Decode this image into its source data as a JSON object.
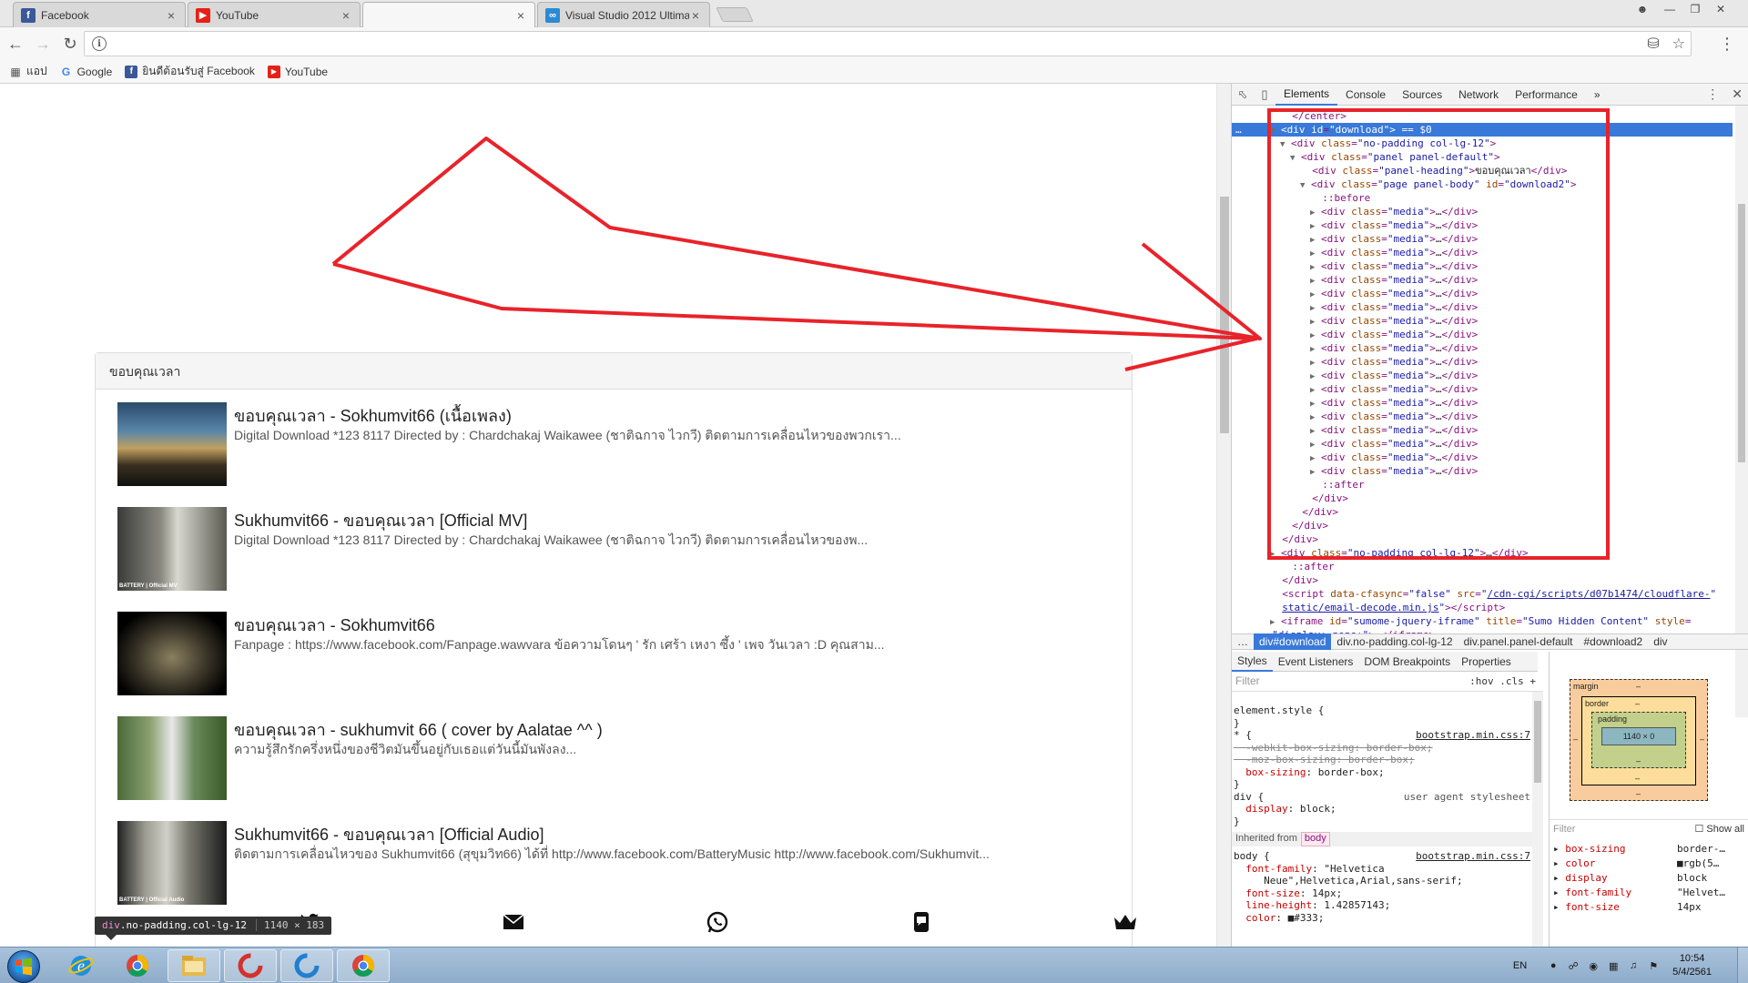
{
  "browser": {
    "tabs": [
      {
        "title": "Facebook",
        "icon": "facebook-icon",
        "color": "#3b5998",
        "active": false
      },
      {
        "title": "YouTube",
        "icon": "youtube-icon",
        "color": "#e62117",
        "active": false
      },
      {
        "title": "",
        "icon": "",
        "color": "",
        "active": true
      },
      {
        "title": "Visual Studio 2012 Ultima",
        "icon": "visual-studio-icon",
        "color": "#2a8ad4",
        "active": false
      }
    ],
    "address": "",
    "bookmarks": [
      {
        "label": "แอป",
        "icon": "apps-grid-icon"
      },
      {
        "label": "Google",
        "icon": "google-icon"
      },
      {
        "label": "ยินดีต้อนรับสู่ Facebook",
        "icon": "facebook-icon"
      },
      {
        "label": "YouTube",
        "icon": "youtube-icon"
      }
    ]
  },
  "page": {
    "panel_heading": "ขอบคุณเวลา",
    "videos": [
      {
        "title": "ขอบคุณเวลา - Sokhumvit66 (เนื้อเพลง)",
        "description": "Digital Download *123 8117 Directed by : Chardchakaj Waikawee (ชาติฉกาจ ไวกวี) ติดตามการเคลื่อนไหวของพวกเรา..."
      },
      {
        "title": "Sukhumvit66 - ขอบคุณเวลา [Official MV]",
        "description": "Digital Download *123 8117 Directed by : Chardchakaj Waikawee (ชาติฉกาจ ไวกวี) ติดตามการเคลื่อนไหวของพ..."
      },
      {
        "title": "ขอบคุณเวลา - Sokhumvit66",
        "description": "Fanpage : https://www.facebook.com/Fanpage.wawvara ข้อความโดนๆ ' รัก เศร้า เหงา ซึ้ง ' เพจ วันเวลา :D คุณสาม..."
      },
      {
        "title": "ขอบคุณเวลา - sukhumvit 66 ( cover by Aalatae ^^ )",
        "description": "ความรู้สึกรักครึ่งหนึ่งของชีวิตมันขึ้นอยู่กับเธอแต่วันนี้มันพังลง..."
      },
      {
        "title": "Sukhumvit66 - ขอบคุณเวลา [Official Audio]",
        "description": "ติดตามการเคลื่อนไหวของ Sukhumvit66 (สุขุมวิท66) ได้ที่ http://www.facebook.com/BatteryMusic http://www.facebook.com/Sukhumvit..."
      }
    ],
    "thumb_badges": [
      "",
      "BATTERY | Official MV",
      "",
      "",
      "BATTERY | Official Audio"
    ],
    "hover_tip": {
      "tag": "div",
      "classes": ".no-padding.col-lg-12",
      "dims": "1140 × 183"
    }
  },
  "devtools": {
    "tabs": [
      "Elements",
      "Console",
      "Sources",
      "Network",
      "Performance"
    ],
    "more": "»",
    "elements_lines": [
      {
        "indent": 3,
        "arrow": "",
        "html": "<span class='tag'>&lt;/center&gt;</span>"
      },
      {
        "indent": 2,
        "arrow": "▼",
        "sel": true,
        "html": "<span class='tag'>&lt;div</span> <span class='an'>id</span>=<span class='av'>\"download\"</span><span class='tag'>&gt;</span> <span class='tx'>== $0</span>"
      },
      {
        "indent": 3,
        "arrow": "▼",
        "html": "<span class='tag'>&lt;div</span> <span class='an'>class</span>=<span class='av'>\"no-padding col-lg-12\"</span><span class='tag'>&gt;</span>"
      },
      {
        "indent": 4,
        "arrow": "▼",
        "html": "<span class='tag'>&lt;div</span> <span class='an'>class</span>=<span class='av'>\"panel panel-default\"</span><span class='tag'>&gt;</span>"
      },
      {
        "indent": 5,
        "arrow": "",
        "html": "<span class='tag'>&lt;div</span> <span class='an'>class</span>=<span class='av'>\"panel-heading\"</span><span class='tag'>&gt;</span><span class='tx'>ขอบคุณเวลา</span><span class='tag'>&lt;/div&gt;</span>"
      },
      {
        "indent": 5,
        "arrow": "▼",
        "html": "<span class='tag'>&lt;div</span> <span class='an'>class</span>=<span class='av'>\"page panel-body\"</span> <span class='an'>id</span>=<span class='av'>\"download2\"</span><span class='tag'>&gt;</span>"
      },
      {
        "indent": 6,
        "arrow": "",
        "html": "<span class='pseudo'>::before</span>"
      },
      {
        "indent": 6,
        "arrow": "▶",
        "media": true
      },
      {
        "indent": 6,
        "arrow": "▶",
        "media": true
      },
      {
        "indent": 6,
        "arrow": "▶",
        "media": true
      },
      {
        "indent": 6,
        "arrow": "▶",
        "media": true
      },
      {
        "indent": 6,
        "arrow": "▶",
        "media": true
      },
      {
        "indent": 6,
        "arrow": "▶",
        "media": true
      },
      {
        "indent": 6,
        "arrow": "▶",
        "media": true
      },
      {
        "indent": 6,
        "arrow": "▶",
        "media": true
      },
      {
        "indent": 6,
        "arrow": "▶",
        "media": true
      },
      {
        "indent": 6,
        "arrow": "▶",
        "media": true
      },
      {
        "indent": 6,
        "arrow": "▶",
        "media": true
      },
      {
        "indent": 6,
        "arrow": "▶",
        "media": true
      },
      {
        "indent": 6,
        "arrow": "▶",
        "media": true
      },
      {
        "indent": 6,
        "arrow": "▶",
        "media": true
      },
      {
        "indent": 6,
        "arrow": "▶",
        "media": true
      },
      {
        "indent": 6,
        "arrow": "▶",
        "media": true
      },
      {
        "indent": 6,
        "arrow": "▶",
        "media": true
      },
      {
        "indent": 6,
        "arrow": "▶",
        "media": true
      },
      {
        "indent": 6,
        "arrow": "▶",
        "media": true
      },
      {
        "indent": 6,
        "arrow": "▶",
        "media": true
      },
      {
        "indent": 6,
        "arrow": "",
        "html": "<span class='pseudo'>::after</span>"
      },
      {
        "indent": 5,
        "arrow": "",
        "html": "<span class='tag'>&lt;/div&gt;</span>"
      },
      {
        "indent": 4,
        "arrow": "",
        "html": "<span class='tag'>&lt;/div&gt;</span>"
      },
      {
        "indent": 3,
        "arrow": "",
        "html": "<span class='tag'>&lt;/div&gt;</span>"
      },
      {
        "indent": 2,
        "arrow": "",
        "html": "<span class='tag'>&lt;/div&gt;</span>"
      },
      {
        "indent": 2,
        "arrow": "▶",
        "html": "<span class='tag'>&lt;div</span> <span class='an'>class</span>=<span class='av'>\"no-padding col-lg-12\"</span><span class='tag'>&gt;</span><span class='tx'>…</span><span class='tag'>&lt;/div&gt;</span>"
      },
      {
        "indent": 3,
        "arrow": "",
        "html": "<span class='pseudo'>::after</span>"
      },
      {
        "indent": 2,
        "arrow": "",
        "html": "<span class='tag'>&lt;/div&gt;</span>"
      },
      {
        "indent": 2,
        "arrow": "",
        "html": "<span class='tag'>&lt;script</span> <span class='an'>data-cfasync</span>=<span class='av'>\"false\"</span> <span class='an'>src</span>=<span class='av'>\"<u>/cdn-cgi/scripts/d07b1474/cloudflare-</u>\"</span>"
      },
      {
        "indent": 2,
        "arrow": "",
        "html": "<span class='av'><u>static/email-decode.min.js</u>\"</span><span class='tag'>&gt;&lt;/script&gt;</span>"
      },
      {
        "indent": 2,
        "arrow": "▶",
        "html": "<span class='tag'>&lt;iframe</span> <span class='an'>id</span>=<span class='av'>\"sumome-jquery-iframe\"</span> <span class='an'>title</span>=<span class='av'>\"Sumo Hidden Content\"</span> <span class='an'>style</span>="
      },
      {
        "indent": 1,
        "arrow": "",
        "html": "<span class='av'>\"display: none;\"</span><span class='tag'>&gt;</span><span class='tx'>…</span><span class='tag'>&lt;/iframe&gt;</span>"
      }
    ],
    "media_line": "<span class='tag'>&lt;div</span> <span class='an'>class</span>=<span class='av'>\"media\"</span><span class='tag'>&gt;</span><span class='tx'>…</span><span class='tag'>&lt;/div&gt;</span>",
    "breadcrumbs": [
      "…",
      "div#download",
      "div.no-padding.col-lg-12",
      "div.panel.panel-default",
      "#download2",
      "div"
    ],
    "sub_tabs": [
      "Styles",
      "Event Listeners",
      "DOM Breakpoints",
      "Properties"
    ],
    "styles_filter": "Filter",
    "styles_opts": ":hov  .cls  +",
    "styles_lines": [
      {
        "t": "element.style {"
      },
      {
        "t": "}"
      },
      {
        "t": "* {",
        "src": "bootstrap.min.css:7"
      },
      {
        "t": "  -webkit-box-sizing: border-box;",
        "strike": true
      },
      {
        "t": "  -moz-box-sizing: border-box;",
        "strike": true
      },
      {
        "t": "  box-sizing: border-box;",
        "prop": "box-sizing",
        "val": " border-box;"
      },
      {
        "t": "}"
      },
      {
        "t": "div {",
        "src": "user agent stylesheet",
        "ua": true
      },
      {
        "t": "  display: block;",
        "prop": "display",
        "val": " block;"
      },
      {
        "t": "}"
      }
    ],
    "inherited_label": "Inherited from",
    "inherited_tag": "body",
    "body_lines": [
      {
        "t": "body {",
        "src": "bootstrap.min.css:7"
      },
      {
        "t": "  font-family: \"Helvetica",
        "prop": "font-family",
        "val": " \"Helvetica"
      },
      {
        "t": "     Neue\",Helvetica,Arial,sans-serif;"
      },
      {
        "t": "  font-size: 14px;",
        "prop": "font-size",
        "val": " 14px;"
      },
      {
        "t": "  line-height: 1.42857143;",
        "prop": "line-height",
        "val": " 1.42857143;"
      },
      {
        "t": "  color: ■#333;",
        "prop": "color",
        "val": " ■#333;"
      }
    ],
    "box_model": {
      "margin": "margin",
      "border": "border",
      "padding": "padding",
      "content": "1140 × 0",
      "dash": "–"
    },
    "computed_filter": "Filter",
    "show_all": "Show all",
    "computed": [
      {
        "prop": "box-sizing",
        "val": "border-…"
      },
      {
        "prop": "color",
        "val": "■rgb(5…"
      },
      {
        "prop": "display",
        "val": "block"
      },
      {
        "prop": "font-family",
        "val": "\"Helvet…"
      },
      {
        "prop": "font-size",
        "val": "14px"
      }
    ]
  },
  "taskbar": {
    "apps": [
      "start-orb",
      "internet-explorer-icon",
      "chrome-icon",
      "file-explorer-icon",
      "app-c-icon",
      "app-e-icon",
      "chrome-icon"
    ],
    "lang": "EN",
    "time": "10:54",
    "date": "5/4/2561"
  },
  "colors": {
    "annotation": "#e8232a",
    "devtools_blue": "#3879d9"
  }
}
